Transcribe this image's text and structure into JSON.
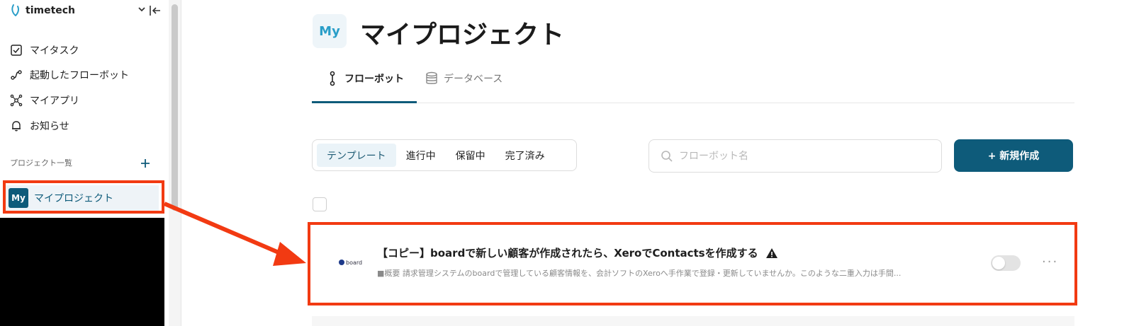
{
  "brand": {
    "name": "timetech",
    "logo": "timetech-logo-icon"
  },
  "sidebar": {
    "items": [
      {
        "label": "マイタスク",
        "icon": "checkbox-icon"
      },
      {
        "label": "起動したフローボット",
        "icon": "flow-icon"
      },
      {
        "label": "マイアプリ",
        "icon": "apps-icon"
      },
      {
        "label": "お知らせ",
        "icon": "bell-icon"
      }
    ],
    "section_label": "プロジェクト一覧",
    "project": {
      "avatar": "My",
      "label": "マイプロジェクト"
    }
  },
  "page": {
    "avatar": "My",
    "title": "マイプロジェクト",
    "tabs": [
      {
        "label": "フローボット",
        "active": true
      },
      {
        "label": "データベース",
        "active": false
      }
    ],
    "filters": [
      {
        "label": "テンプレート",
        "active": true
      },
      {
        "label": "進行中",
        "active": false
      },
      {
        "label": "保留中",
        "active": false
      },
      {
        "label": "完了済み",
        "active": false
      }
    ],
    "search_placeholder": "フローボット名",
    "new_button": "+ 新規作成"
  },
  "flowbot": {
    "logo_text": "board",
    "title": "【コピー】boardで新しい顧客が作成されたら、XeroでContactsを作成する",
    "description": "■概要 請求管理システムのboardで管理している顧客情報を、会計ソフトのXeroへ手作業で登録・更新していませんか。このような二重入力は手間...",
    "enabled": false,
    "more": "···"
  },
  "colors": {
    "accent": "#0e5b7a",
    "highlight": "#f23a12",
    "avatar_text": "#2a9ec8"
  }
}
